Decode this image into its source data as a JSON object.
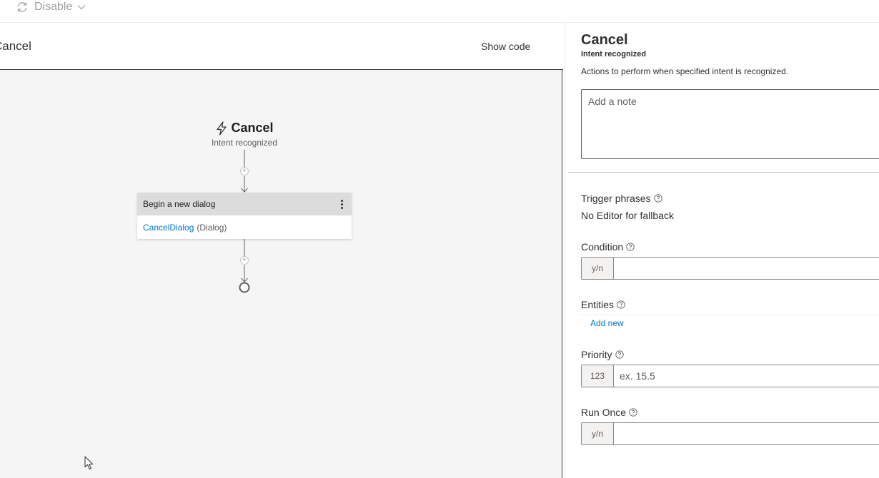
{
  "toolbar": {
    "disable_label": "Disable",
    "sync_icon": "sync-icon",
    "chevron_icon": "chevron-down-icon"
  },
  "editor": {
    "dialog_title": "Cancel",
    "show_code_label": "Show code"
  },
  "flow": {
    "trigger_icon": "lightning-bolt-icon",
    "trigger_title": "Cancel",
    "trigger_subtitle": "Intent recognized",
    "action_card": {
      "title": "Begin a new dialog",
      "dialog_link": "CancelDialog",
      "dialog_type": "(Dialog)"
    }
  },
  "panel": {
    "title": "Cancel",
    "subtitle": "Intent recognized",
    "description": "Actions to perform when specified intent is recognized.",
    "note_placeholder": "Add a note",
    "trigger_phrases": {
      "label": "Trigger phrases",
      "value": "No Editor for fallback"
    },
    "condition": {
      "label": "Condition",
      "prefix": "y/n",
      "value": ""
    },
    "entities": {
      "label": "Entities",
      "add_new_label": "Add new"
    },
    "priority": {
      "label": "Priority",
      "prefix": "123",
      "placeholder": "ex. 15.5"
    },
    "run_once": {
      "label": "Run Once",
      "prefix": "y/n",
      "value": ""
    }
  },
  "colors": {
    "accent": "#0078d4",
    "canvas_bg": "#f5f5f5",
    "card_header_bg": "#dcdcdc",
    "text_primary": "#323130",
    "text_secondary": "#605e5c"
  }
}
